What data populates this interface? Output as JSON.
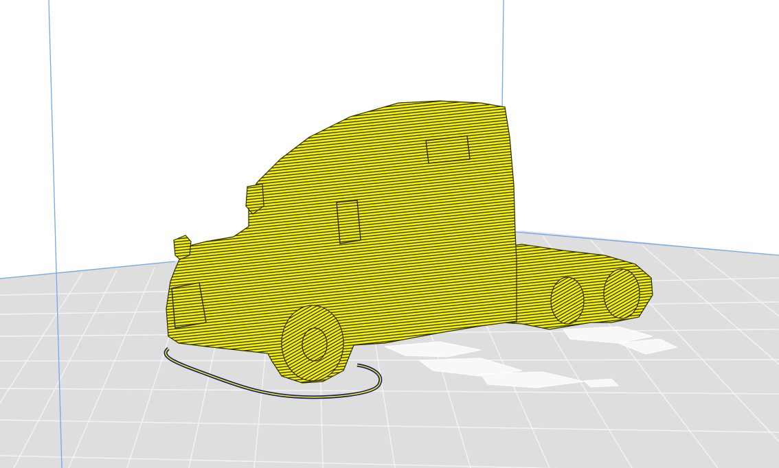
{
  "viewport": {
    "type": "3d-slicer-layer-view",
    "model_name": "truck-cab",
    "colors": {
      "background": "#ffffff",
      "build_plate": "#dedede",
      "grid_line": "#f4f4f4",
      "volume_edge": "#6fa8e8",
      "model_fill": "#f5f200",
      "model_layer_line": "#2b2b00",
      "skirt_outer": "#1a1a7a",
      "skirt_inner": "#f5f200",
      "support_ghost": "#f7f7f7"
    }
  }
}
